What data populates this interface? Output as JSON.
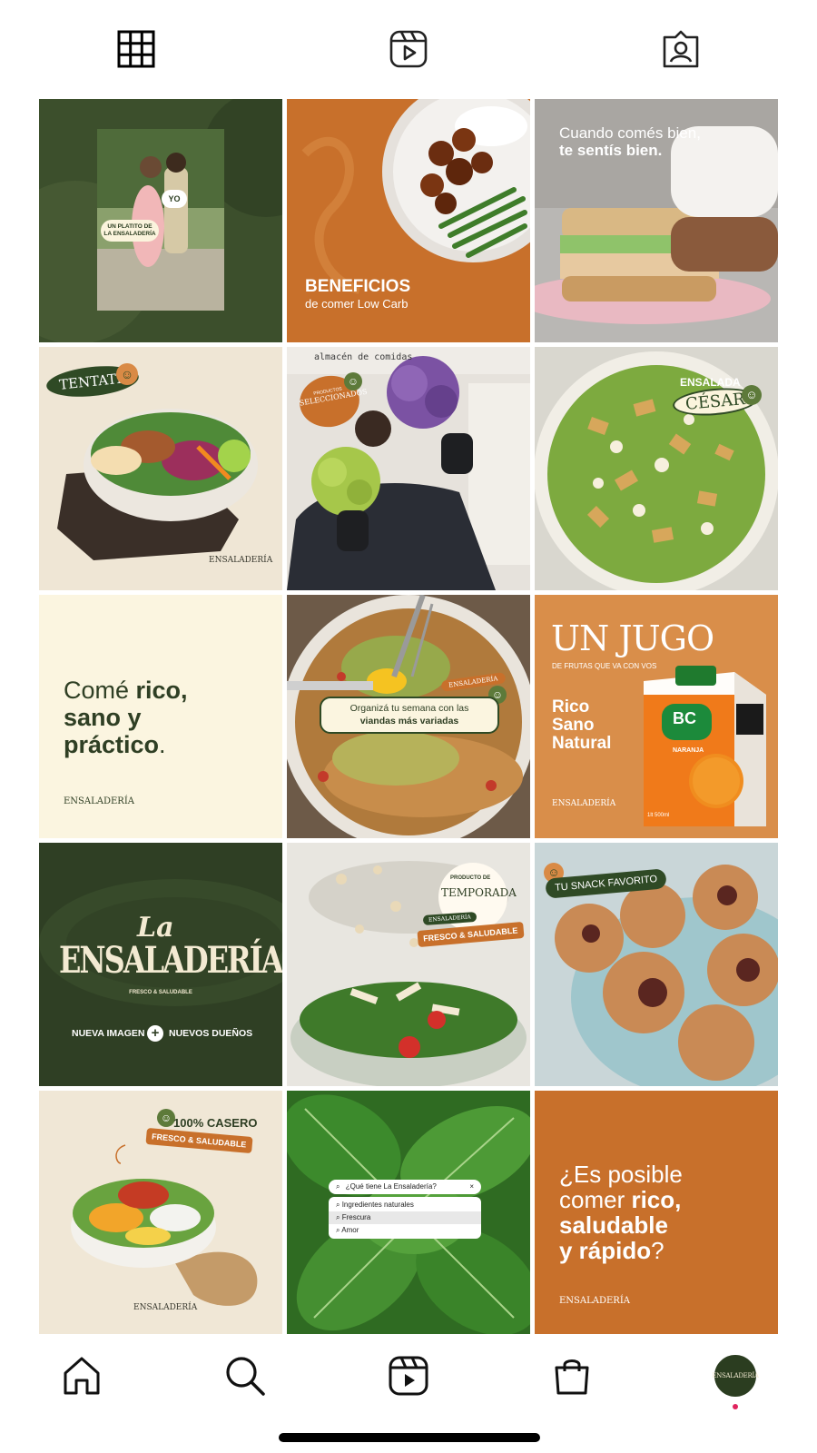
{
  "tabs": [
    {
      "name": "grid-icon"
    },
    {
      "name": "reels-icon"
    },
    {
      "name": "tagged-icon"
    }
  ],
  "posts": {
    "p1": {
      "badge": "YO",
      "caption": "UN PLATITO DE LA ENSALADERÍA"
    },
    "p2": {
      "title": "BENEFICIOS",
      "subtitle": "de comer Low Carb"
    },
    "p3": {
      "line1": "Cuando comés bien,",
      "line2": "te sentís bien."
    },
    "p4": {
      "badge": "TENTATE",
      "logo": "ENSALADERÍA"
    },
    "p5": {
      "sign": "almacén de comidas",
      "badge": "SELECCIONADOS",
      "badge_small": "PRODUCTOS"
    },
    "p6": {
      "label": "ENSALADA",
      "title": "CÉSAR"
    },
    "p7": {
      "line1a": "Comé ",
      "line1b": "rico,",
      "line2": "sano y",
      "line3a": "práctico",
      "line3b": ".",
      "logo": "ENSALADERÍA"
    },
    "p8": {
      "logo": "ENSALADERÍA",
      "line1": "Organizá tu semana con las",
      "line2": "viandas más variadas"
    },
    "p9": {
      "title": "UN JUGO",
      "subtitle": "DE FRUTAS QUE VA CON VOS",
      "w1": "Rico",
      "w2": "Sano",
      "w3": "Natural",
      "logo": "ENSALADERÍA",
      "brand": "BC",
      "flavor": "NARANJA",
      "size": "1lt 500ml"
    },
    "p10": {
      "la": "La",
      "name": "ENSALADERÍA",
      "tag": "FRESCO & SALUDABLE",
      "left": "NUEVA IMAGEN",
      "right": "NUEVOS DUEÑOS"
    },
    "p11": {
      "seal_small": "PRODUCTO DE",
      "seal": "TEMPORADA",
      "logo": "ENSALADERÍA",
      "tag": "FRESCO & SALUDABLE"
    },
    "p12": {
      "label": "TU SNACK FAVORITO"
    },
    "p13": {
      "title": "100% CASERO",
      "tag": "FRESCO & SALUDABLE",
      "logo": "ENSALADERÍA"
    },
    "p14": {
      "query": "¿Qué tiene La Ensaladería?",
      "s1": "Ingredientes naturales",
      "s2": "Frescura",
      "s3": "Amor"
    },
    "p15": {
      "l1": "¿Es posible",
      "l2a": "comer ",
      "l2b": "rico,",
      "l3": "saludable",
      "l4a": "y rápido",
      "l4b": "?",
      "logo": "ENSALADERÍA"
    }
  },
  "nav": {
    "avatar_label": "ENSALADERÍA"
  },
  "colors": {
    "olive": "#3a4d2a",
    "orange": "#c8722e",
    "cream": "#f9f3df",
    "darkgreen": "#2f3f24"
  }
}
